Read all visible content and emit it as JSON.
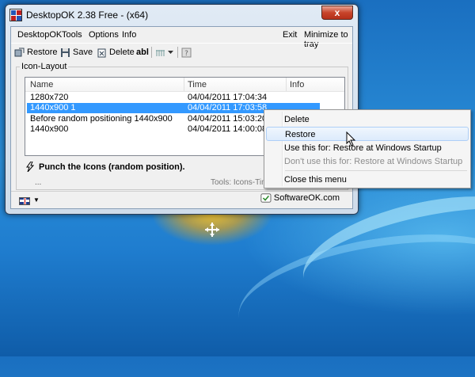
{
  "window": {
    "title": "DesktopOK 2.38 Free - (x64)",
    "close_label": "x"
  },
  "menubar": {
    "items": [
      "DesktopOK",
      "Tools",
      "Options",
      "Info"
    ],
    "exit_label": "Exit",
    "tray_label": "Minimize to tray"
  },
  "toolbar": {
    "restore_label": "Restore",
    "save_label": "Save",
    "delete_label": "Delete",
    "abl_label": "abl"
  },
  "group": {
    "legend": "Icon-Layout"
  },
  "list": {
    "columns": [
      "Name",
      "Time",
      "Info"
    ],
    "rows": [
      {
        "name": "1280x720",
        "time": "04/04/2011 17:04:34"
      },
      {
        "name": "1440x900 1",
        "time": "04/04/2011 17:03:58"
      },
      {
        "name": "Before random positioning 1440x900",
        "time": "04/04/2011 15:03:20"
      },
      {
        "name": "1440x900",
        "time": "04/04/2011 14:00:08"
      }
    ],
    "selected_index": 1
  },
  "punch_label": "Punch the Icons (random position).",
  "dots_label": "...",
  "tools_label": "Tools: Icons-Timer",
  "context_menu": {
    "items": [
      {
        "label": "Delete"
      },
      {
        "label": "Restore"
      },
      {
        "label": "Use this for: Restore at Windows Startup"
      },
      {
        "label": "Don't use this for: Restore at Windows Startup"
      },
      {
        "label": "Close this menu"
      }
    ]
  },
  "softwareok_label": "SoftwareOK.com",
  "colors": {
    "selection": "#3399ff",
    "desktop": "#1f7dcf"
  }
}
